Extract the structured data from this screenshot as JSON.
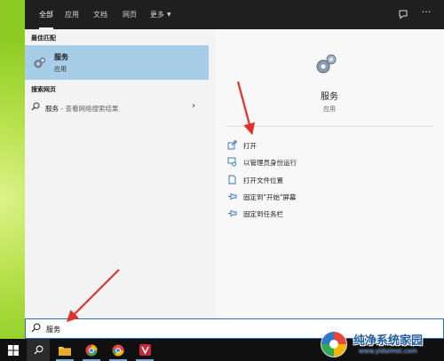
{
  "search_window": {
    "tabs": [
      {
        "label": "全部",
        "active": true
      },
      {
        "label": "应用",
        "active": false
      },
      {
        "label": "文档",
        "active": false
      },
      {
        "label": "网页",
        "active": false
      },
      {
        "label": "更多",
        "active": false
      }
    ],
    "top_icons": [
      "feedback-icon",
      "more-options-icon"
    ]
  },
  "results": {
    "best_match_header": "最佳匹配",
    "best_match": {
      "title": "服务",
      "subtitle": "应用",
      "icon": "gear-icon"
    },
    "web_header": "搜索网页",
    "web_result": {
      "query": "服务",
      "suffix": " - 查看网络搜索结果",
      "icon": "search-icon"
    }
  },
  "detail": {
    "title": "服务",
    "subtitle": "应用",
    "icon": "gear-icon",
    "actions": [
      {
        "label": "打开",
        "icon": "open-icon"
      },
      {
        "label": "以管理员身份运行",
        "icon": "admin-icon"
      },
      {
        "label": "打开文件位置",
        "icon": "file-icon"
      },
      {
        "label": "固定到\"开始\"屏幕",
        "icon": "pin-icon"
      },
      {
        "label": "固定到任务栏",
        "icon": "pin-icon"
      }
    ]
  },
  "search_box": {
    "value": "服务",
    "icon": "search-icon"
  },
  "taskbar": {
    "items": [
      "windows-start-icon",
      "search-icon",
      "file-explorer-icon",
      "browser-icon",
      "chrome-icon",
      "app-icon"
    ]
  },
  "watermark": {
    "text": "纯净系统家园",
    "url": "www.yidaimei.com"
  },
  "colors": {
    "accent": "#2f6fb5",
    "selected": "#a8cde8",
    "arrow": "#e0312a"
  }
}
